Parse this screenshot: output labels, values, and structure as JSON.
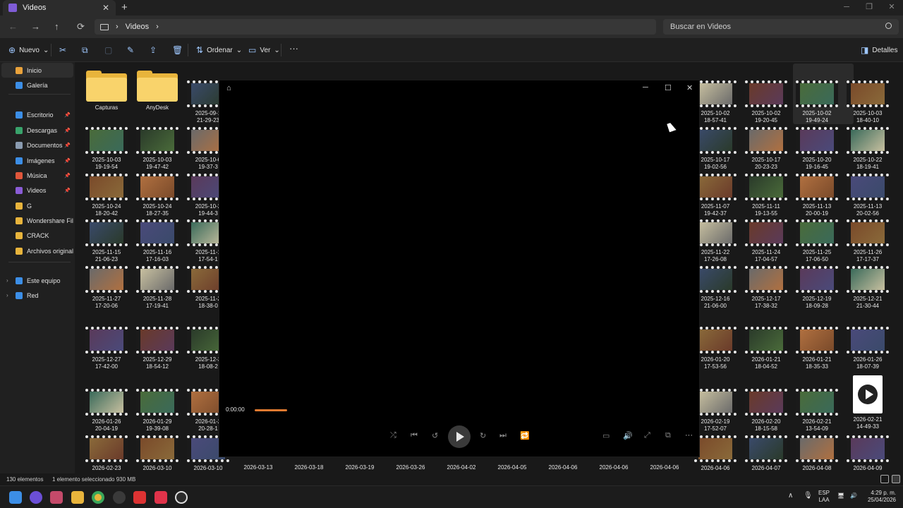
{
  "window": {
    "tab_title": "Videos",
    "tab_close": "✕",
    "tab_add": "+",
    "minimize": "─",
    "maximize": "❐",
    "close": "✕"
  },
  "address": {
    "back": "←",
    "forward": "→",
    "up": "↑",
    "refresh": "⟳",
    "crumb_sep": "›",
    "crumb": "Videos",
    "search_placeholder": "Buscar en Videos"
  },
  "toolbar": {
    "new_label": "Nuevo",
    "sort_label": "Ordenar",
    "view_label": "Ver",
    "more": "···",
    "details_label": "Detalles",
    "cut": "✂",
    "copy": "⧉",
    "paste": "▢",
    "rename": "✎",
    "share": "⇪",
    "delete": "🗑"
  },
  "sidebar": {
    "items": [
      {
        "label": "Inicio",
        "color": "#e9a23b",
        "pinned": false
      },
      {
        "label": "Galería",
        "color": "#3c8ee6",
        "pinned": false
      },
      {
        "label": "Escritorio",
        "color": "#3c8ee6",
        "pinned": true
      },
      {
        "label": "Descargas",
        "color": "#39a36b",
        "pinned": true
      },
      {
        "label": "Documentos",
        "color": "#8a9bb0",
        "pinned": true
      },
      {
        "label": "Imágenes",
        "color": "#3c8ee6",
        "pinned": true
      },
      {
        "label": "Música",
        "color": "#e0563b",
        "pinned": true
      },
      {
        "label": "Videos",
        "color": "#8a5cd6",
        "pinned": true
      },
      {
        "label": "G",
        "color": "#e8b43c",
        "pinned": false
      },
      {
        "label": "Wondershare Filmo",
        "color": "#e8b43c",
        "pinned": false
      },
      {
        "label": "CRACK",
        "color": "#e8b43c",
        "pinned": false
      },
      {
        "label": "Archivos originales",
        "color": "#e8b43c",
        "pinned": false
      },
      {
        "label": "Este equipo",
        "color": "#3c8ee6",
        "pinned": false
      },
      {
        "label": "Red",
        "color": "#3c8ee6",
        "pinned": false
      }
    ]
  },
  "files": {
    "folders": [
      "Capturas",
      "AnyDesk"
    ],
    "left_col1": [
      [
        "2025-10-03",
        "19-19-54"
      ],
      [
        "2025-10-24",
        "18-20-42"
      ],
      [
        "2025-11-15",
        "21-06-23"
      ],
      [
        "2025-11-27",
        "17-20-06"
      ],
      [
        "2025-12-27",
        "17-42-00"
      ],
      [
        "2026-01-26",
        "20-04-19"
      ],
      [
        "2026-02-23",
        ""
      ]
    ],
    "left_col2": [
      [
        "2025-10-03",
        "19-47-42"
      ],
      [
        "2025-10-24",
        "18-27-35"
      ],
      [
        "2025-11-16",
        "17-16-03"
      ],
      [
        "2025-11-28",
        "17-19-41"
      ],
      [
        "2025-12-29",
        "18-54-12"
      ],
      [
        "2026-01-29",
        "19-39-08"
      ],
      [
        "2026-03-10",
        ""
      ]
    ],
    "left_col3": [
      [
        "2025-09-1",
        "21-29-23"
      ],
      [
        "2025-10-0",
        "19-37-3"
      ],
      [
        "2025-10-2",
        "19-44-3"
      ],
      [
        "2025-11-1",
        "17-54-1"
      ],
      [
        "2025-11-2",
        "18-38-0"
      ],
      [
        "2025-12-3",
        "18-08-2"
      ],
      [
        "2026-01-2",
        "20-28-1"
      ],
      [
        "2026-03-10",
        ""
      ]
    ],
    "right_rows": [
      [
        [
          "2025-10-02",
          "18-57-41"
        ],
        [
          "2025-10-02",
          "19-20-45"
        ],
        [
          "2025-10-02",
          "19-49-24"
        ],
        [
          "2025-10-03",
          "18-40-10"
        ]
      ],
      [
        [
          "2025-10-17",
          "19-02-56"
        ],
        [
          "2025-10-17",
          "20-23-23"
        ],
        [
          "2025-10-20",
          "19-16-45"
        ],
        [
          "2025-10-22",
          "18-19-41"
        ]
      ],
      [
        [
          "2025-11-07",
          "19-42-37"
        ],
        [
          "2025-11-11",
          "19-13-55"
        ],
        [
          "2025-11-13",
          "20-00-19"
        ],
        [
          "2025-11-13",
          "20-02-56"
        ]
      ],
      [
        [
          "2025-11-22",
          "17-26-08"
        ],
        [
          "2025-11-24",
          "17-04-57"
        ],
        [
          "2025-11-25",
          "17-06-50"
        ],
        [
          "2025-11-26",
          "17-17-37"
        ]
      ],
      [
        [
          "2025-12-16",
          "21-06-00"
        ],
        [
          "2025-12-17",
          "17-38-32"
        ],
        [
          "2025-12-19",
          "18-09-28"
        ],
        [
          "2025-12-21",
          "21-30-44"
        ]
      ],
      [
        [
          "2026-01-20",
          "17-53-56"
        ],
        [
          "2026-01-21",
          "18-04-52"
        ],
        [
          "2026-01-21",
          "18-35-33"
        ],
        [
          "2026-01-26",
          "18-07-39"
        ]
      ],
      [
        [
          "2026-02-19",
          "17-52-07"
        ],
        [
          "2026-02-20",
          "18-15-58"
        ],
        [
          "2026-02-21",
          "13-54-09"
        ],
        [
          "2026-02-21",
          "14-49-33"
        ]
      ],
      [
        [
          "2026-04-06",
          ""
        ],
        [
          "2026-04-07",
          ""
        ],
        [
          "2026-04-08",
          ""
        ],
        [
          "2026-04-09",
          ""
        ]
      ]
    ],
    "bottom_row": [
      "2026-03-13",
      "2026-03-18",
      "2026-03-19",
      "2026-03-26",
      "2026-04-02",
      "2026-04-05",
      "2026-04-06",
      "2026-04-06",
      "2026-04-06"
    ]
  },
  "player": {
    "home": "⌂",
    "minimize": "─",
    "maximize": "☐",
    "close": "✕",
    "time": "0:00:00",
    "progress": 0.08,
    "shuffle": "⤮",
    "prev": "⏮",
    "rewind": "↺",
    "forward": "↻",
    "next": "⏭",
    "repeat": "🔁",
    "subtitles": "▭",
    "volume": "🔊",
    "fullscreen": "⤢",
    "miniview": "⧉",
    "more": "···"
  },
  "status": {
    "count": "130 elementos",
    "selected": "1 elemento seleccionado  930 MB"
  },
  "taskbar": {
    "lang": "ESP",
    "lang2": "LAA",
    "time": "4:29 p. m.",
    "date": "25/04/2026",
    "chevron": "∧"
  },
  "colors": {
    "accent": "#e07a30",
    "folder": "#e8b43c"
  }
}
